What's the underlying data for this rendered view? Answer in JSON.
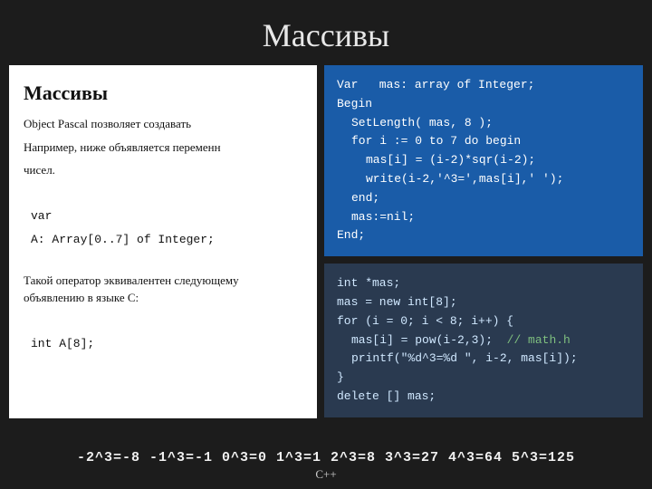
{
  "title": "Массивы",
  "left_panel": {
    "heading": "Массивы",
    "para1": "Object Pascal позволяет создавать",
    "para2": "Например, ниже объявляется переменн",
    "para3": "чисел.",
    "var_keyword": "var",
    "array_decl": "  A: Array[0..7] of Integer;",
    "equiv_text": "Такой оператор эквивалентен следующему объявлению в языке С:",
    "int_decl": "int A[8];"
  },
  "code_blue": {
    "lines": [
      "Var   mas: array of Integer;",
      "Begin",
      "  SetLength( mas, 8 );",
      "  for i := 0 to 7 do begin",
      "    mas[i] = (i-2)*sqr(i-2);",
      "    write(i-2,'^3=',mas[i],' ');",
      "  end;",
      "  mas:=nil;",
      "End;"
    ]
  },
  "code_dark": {
    "lines": [
      "int *mas;",
      "mas = new int[8];",
      "for (i = 0; i < 8; i++) {",
      "  mas[i] = pow(i-2,3);  // math.h",
      "  printf(\"%d^3=%d \", i-2, mas[i]);",
      "}",
      "delete [] mas;"
    ],
    "comment": "// math.h"
  },
  "bottom": {
    "sequence": "-2^3=-8  -1^3=-1  0^3=0  1^3=1  2^3=8  3^3=27  4^3=64  5^3=125",
    "label": "C++"
  }
}
